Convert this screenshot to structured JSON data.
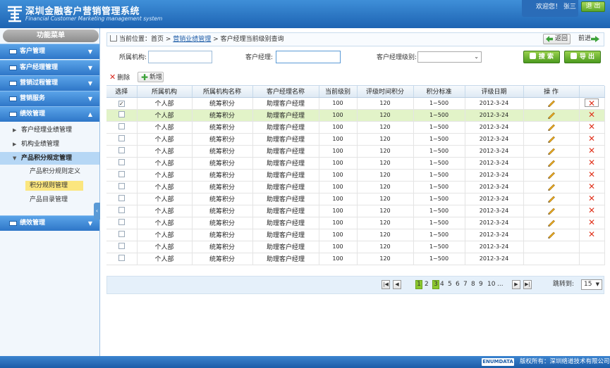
{
  "header": {
    "title_cn": "深圳金融客户营销管理系统",
    "title_en": "Financial Customer Marketing management system",
    "welcome": "欢迎您！ 张三",
    "logout": "退 出"
  },
  "sidebar": {
    "title": "功能菜单",
    "menus": [
      "客户管理",
      "客户经理管理",
      "营销过程管理",
      "营销服务",
      "绩效管理"
    ],
    "sub_items": [
      "客户经理业绩管理",
      "机构业绩管理",
      "产品积分规定管理"
    ],
    "leaves": [
      "产品积分规则定义",
      "积分规则管理",
      "产品目录管理"
    ],
    "bottom_menu": "绩效管理"
  },
  "breadcrumb": {
    "prefix": "当前位置：首页 >",
    "link": "营销业绩管理",
    "current": "> 客户经理当前级别查询",
    "back": "返回",
    "forward": "前进"
  },
  "filters": {
    "org_label": "所属机构:",
    "manager_label": "客户经理:",
    "level_label": "客户经理级别:",
    "search": "搜 索",
    "export": "导 出"
  },
  "toolbar": {
    "delete": "删除",
    "add": "新增"
  },
  "table": {
    "headers": [
      "选择",
      "所属机构",
      "所属机构名称",
      "客户经理名称",
      "当前级别",
      "评级时间积分",
      "积分标准",
      "评级日期",
      "操 作"
    ],
    "rows": [
      {
        "checked": "✓",
        "org": "个人部",
        "org_name": "统筹积分",
        "mgr": "助理客户经理",
        "level": "100",
        "score": "120",
        "std": "1~500",
        "date": "2012-3-24"
      },
      {
        "checked": "",
        "org": "个人部",
        "org_name": "统筹积分",
        "mgr": "助理客户经理",
        "level": "100",
        "score": "120",
        "std": "1~500",
        "date": "2012-3-24"
      },
      {
        "checked": "",
        "org": "个人部",
        "org_name": "统筹积分",
        "mgr": "助理客户经理",
        "level": "100",
        "score": "120",
        "std": "1~500",
        "date": "2012-3-24"
      },
      {
        "checked": "",
        "org": "个人部",
        "org_name": "统筹积分",
        "mgr": "助理客户经理",
        "level": "100",
        "score": "120",
        "std": "1~500",
        "date": "2012-3-24"
      },
      {
        "checked": "",
        "org": "个人部",
        "org_name": "统筹积分",
        "mgr": "助理客户经理",
        "level": "100",
        "score": "120",
        "std": "1~500",
        "date": "2012-3-24"
      },
      {
        "checked": "",
        "org": "个人部",
        "org_name": "统筹积分",
        "mgr": "助理客户经理",
        "level": "100",
        "score": "120",
        "std": "1~500",
        "date": "2012-3-24"
      },
      {
        "checked": "",
        "org": "个人部",
        "org_name": "统筹积分",
        "mgr": "助理客户经理",
        "level": "100",
        "score": "120",
        "std": "1~500",
        "date": "2012-3-24"
      },
      {
        "checked": "",
        "org": "个人部",
        "org_name": "统筹积分",
        "mgr": "助理客户经理",
        "level": "100",
        "score": "120",
        "std": "1~500",
        "date": "2012-3-24"
      },
      {
        "checked": "",
        "org": "个人部",
        "org_name": "统筹积分",
        "mgr": "助理客户经理",
        "level": "100",
        "score": "120",
        "std": "1~500",
        "date": "2012-3-24"
      },
      {
        "checked": "",
        "org": "个人部",
        "org_name": "统筹积分",
        "mgr": "助理客户经理",
        "level": "100",
        "score": "120",
        "std": "1~500",
        "date": "2012-3-24"
      },
      {
        "checked": "",
        "org": "个人部",
        "org_name": "统筹积分",
        "mgr": "助理客户经理",
        "level": "100",
        "score": "120",
        "std": "1~500",
        "date": "2012-3-24"
      },
      {
        "checked": "",
        "org": "个人部",
        "org_name": "统筹积分",
        "mgr": "助理客户经理",
        "level": "100",
        "score": "120",
        "std": "1~500",
        "date": "2012-3-24"
      },
      {
        "checked": "",
        "org": "个人部",
        "org_name": "统筹积分",
        "mgr": "助理客户经理",
        "level": "100",
        "score": "120",
        "std": "1~500",
        "date": "2012-3-24"
      },
      {
        "checked": "",
        "org": "个人部",
        "org_name": "统筹积分",
        "mgr": "助理客户经理",
        "level": "100",
        "score": "120",
        "std": "1~500",
        "date": "2012-3-24"
      }
    ]
  },
  "pager": {
    "pages": [
      "1",
      "2",
      "3",
      "4",
      "5",
      "6",
      "7",
      "8",
      "9",
      "10",
      "..."
    ],
    "jump_label": "跳转到:",
    "jump_value": "15"
  },
  "footer": {
    "logo": "ENUMDATA",
    "copyright": "版权所有：深圳络道技术有限公司"
  }
}
